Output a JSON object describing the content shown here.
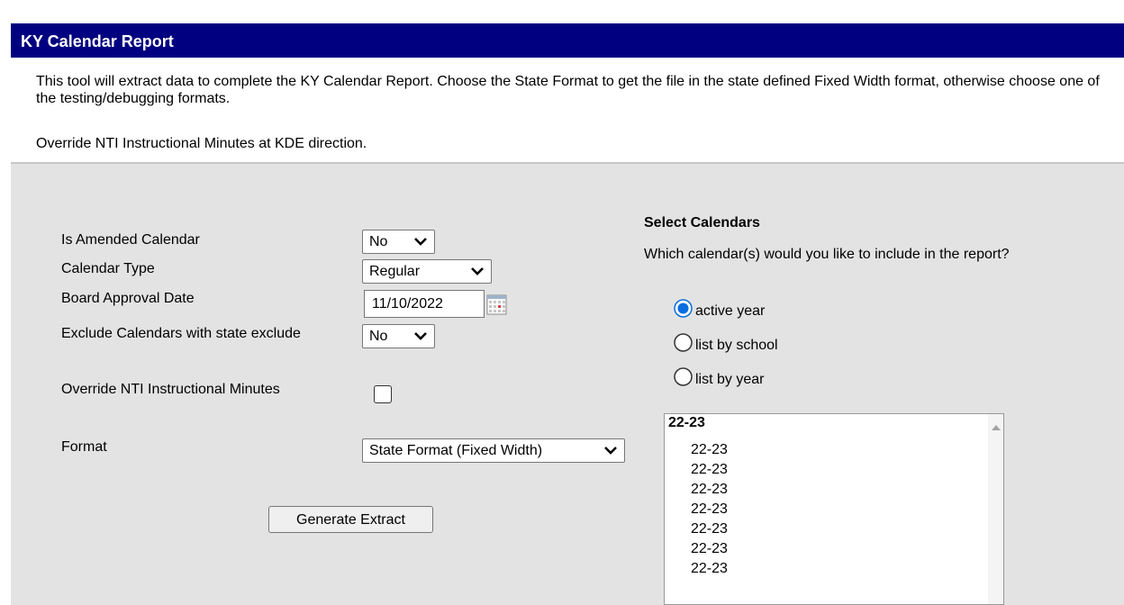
{
  "header": {
    "title": "KY Calendar Report"
  },
  "description": {
    "line1": "This tool will extract data to complete the KY Calendar Report. Choose the State Format to get the file in the state defined Fixed Width format, otherwise choose one of the testing/debugging formats.",
    "line2": "Override NTI Instructional Minutes at KDE direction."
  },
  "form": {
    "amended": {
      "label": "Is Amended Calendar",
      "value": "No"
    },
    "calendar_type": {
      "label": "Calendar Type",
      "value": "Regular"
    },
    "board_approval": {
      "label": "Board Approval Date",
      "value": "11/10/2022"
    },
    "exclude_state": {
      "label": "Exclude Calendars with state exclude",
      "value": "No"
    },
    "override_nti": {
      "label": "Override NTI Instructional Minutes",
      "checked": false
    },
    "format": {
      "label": "Format",
      "value": "State Format (Fixed Width)"
    },
    "generate_label": "Generate Extract"
  },
  "calendars": {
    "heading": "Select Calendars",
    "question": "Which calendar(s) would you like to include in the report?",
    "options": [
      {
        "label": "active year",
        "selected": true
      },
      {
        "label": "list by school",
        "selected": false
      },
      {
        "label": "list by year",
        "selected": false
      }
    ],
    "list": {
      "group": "22-23",
      "items": [
        "22-23",
        "22-23",
        "22-23",
        "22-23",
        "22-23",
        "22-23",
        "22-23"
      ]
    }
  }
}
